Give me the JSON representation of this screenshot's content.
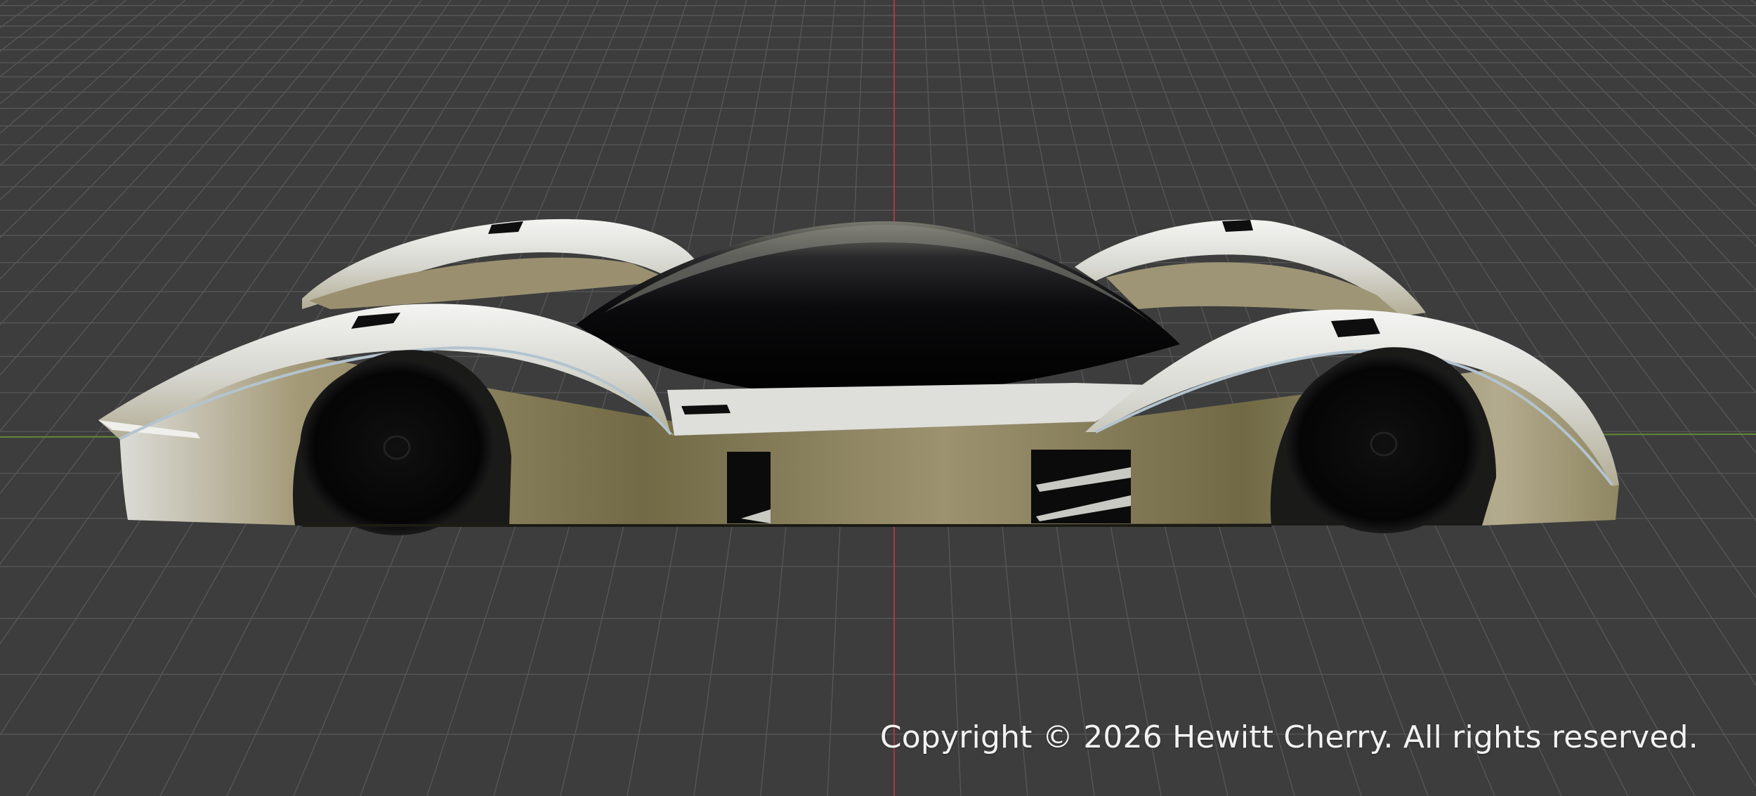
{
  "viewport": {
    "background_color": "#3d3d3d",
    "grid_color": "#575757",
    "x_axis_color": "#6a9a3a",
    "z_axis_color": "#b5384a",
    "view": "perspective side view",
    "model": "race car"
  },
  "model_colors": {
    "body_light": "#e6e6e2",
    "body_tan": "#9c9270",
    "body_shadow": "#575236",
    "canopy": "#0a0a0c",
    "wheels": "#050505",
    "intake": "#0f0f0f"
  },
  "copyright": {
    "text": "Copyright © 2026 Hewitt Cherry. All rights reserved."
  }
}
